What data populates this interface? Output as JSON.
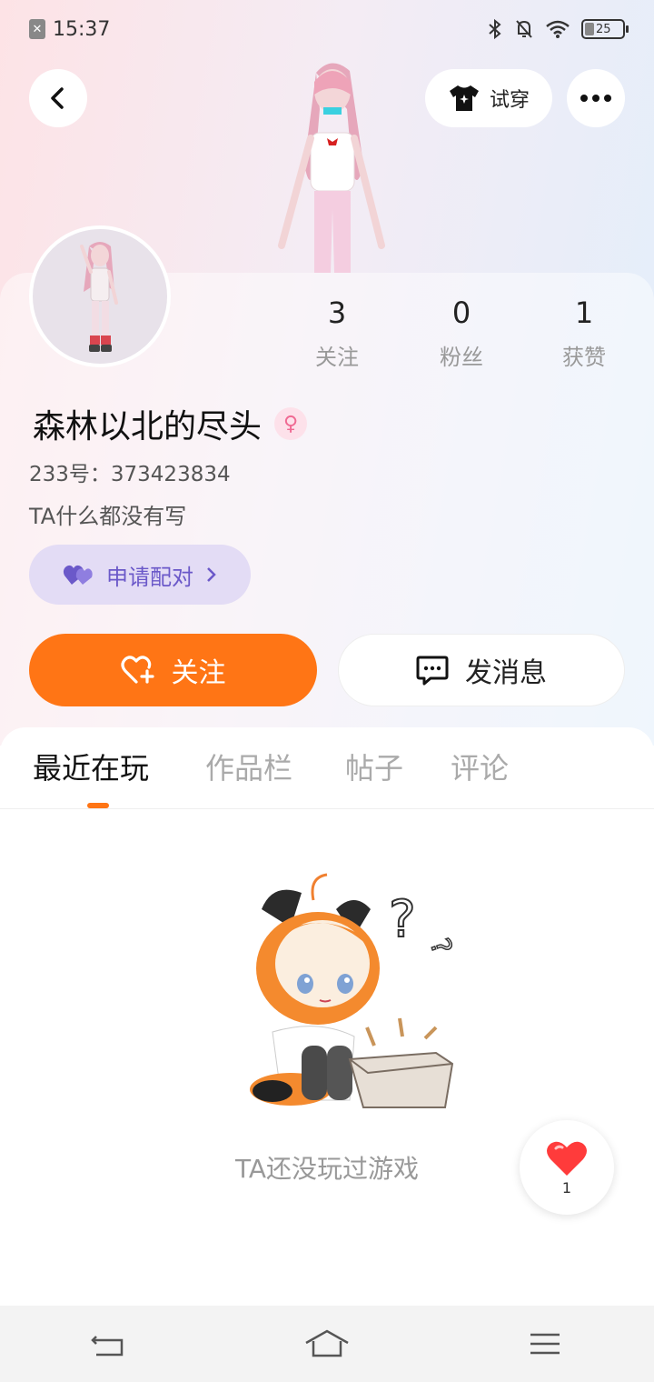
{
  "status_bar": {
    "time": "15:37",
    "battery_level": "25",
    "icons": [
      "sim-x-icon",
      "bluetooth-icon",
      "mute-bell-icon",
      "wifi-icon",
      "battery-icon"
    ]
  },
  "header": {
    "try_on_label": "试穿"
  },
  "profile": {
    "username": "森林以北的尽头",
    "gender_symbol": "♀",
    "user_id": "233号：373423834",
    "bio": "TA什么都没有写",
    "pair_label": "申请配对",
    "stats": [
      {
        "value": "3",
        "label": "关注"
      },
      {
        "value": "0",
        "label": "粉丝"
      },
      {
        "value": "1",
        "label": "获赞"
      }
    ]
  },
  "actions": {
    "follow_label": "关注",
    "message_label": "发消息"
  },
  "tabs": [
    {
      "label": "最近在玩",
      "active": true
    },
    {
      "label": "作品栏",
      "active": false
    },
    {
      "label": "帖子",
      "active": false
    },
    {
      "label": "评论",
      "active": false
    }
  ],
  "empty_state": {
    "text": "TA还没玩过游戏"
  },
  "like_fab": {
    "count": "1"
  },
  "colors": {
    "accent": "#ff7515",
    "pair_text": "#6b59c9",
    "pair_bg": "#e3dcf5"
  }
}
